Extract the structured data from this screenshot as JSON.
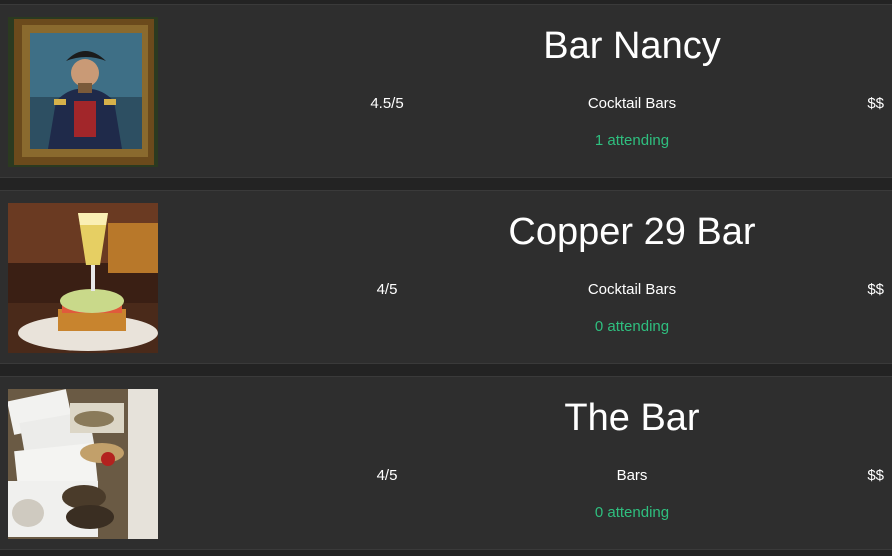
{
  "colors": {
    "background": "#232323",
    "card": "#2e2e2e",
    "text": "#ffffff",
    "attending": "#2fbf7f"
  },
  "bars": [
    {
      "name": "Bar Nancy",
      "rating": "4.5/5",
      "category": "Cocktail Bars",
      "price": "$$",
      "attending": "1 attending",
      "image": "captain-painting-photo"
    },
    {
      "name": "Copper 29 Bar",
      "rating": "4/5",
      "category": "Cocktail Bars",
      "price": "$$",
      "attending": "0 attending",
      "image": "toast-and-mimosa-photo"
    },
    {
      "name": "The Bar",
      "rating": "4/5",
      "category": "Bars",
      "price": "$$",
      "attending": "0 attending",
      "image": "takeout-containers-photo"
    }
  ]
}
